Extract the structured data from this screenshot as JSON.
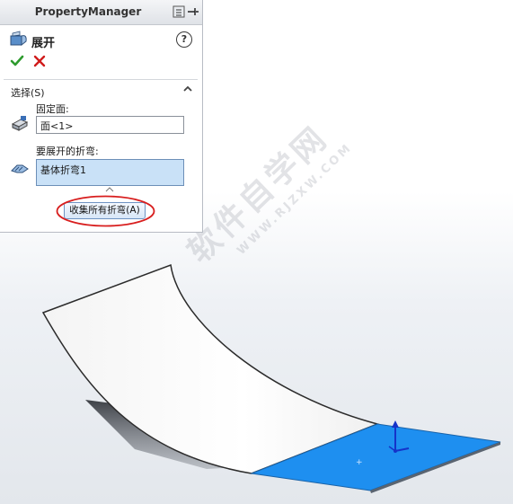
{
  "panel": {
    "title": "PropertyManager",
    "feature_name": "展开",
    "feature_icon": "unfold-icon",
    "ok_icon": "checkmark-icon",
    "cancel_icon": "close-icon",
    "help_icon_text": "?"
  },
  "selection_group": {
    "title": "选择(S)",
    "fixed_face_label": "固定面:",
    "fixed_face_value": "面<1>",
    "bends_label": "要展开的折弯:",
    "bends_value": "基体折弯1",
    "collect_button_label": "收集所有折弯(A)"
  },
  "watermark": {
    "cn_text": "软件自学网",
    "en_text": "WWW.RJZXW.COM"
  },
  "colors": {
    "selected_face": "#1e8ff0",
    "highlight_ellipse": "#d81e1e",
    "selection_field_bg": "#c9e1f7"
  }
}
